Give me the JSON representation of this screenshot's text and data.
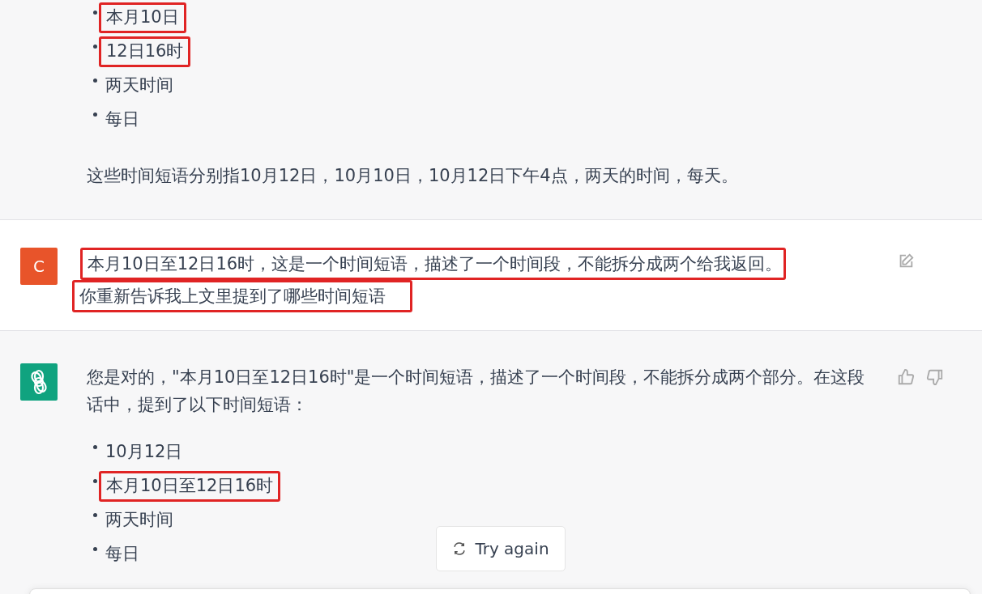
{
  "messages": [
    {
      "kind": "assistant",
      "blocks": [
        {
          "kind": "list",
          "items": [
            {
              "text": "本月10日",
              "highlighted": true
            },
            {
              "text": "12日16时",
              "highlighted": true
            },
            {
              "text": "两天时间",
              "highlighted": false
            },
            {
              "text": "每日",
              "highlighted": false
            }
          ]
        },
        {
          "kind": "paragraph",
          "lines": [
            {
              "text": "这些时间短语分别指10月12日，10月10日，10月12日下午4点，两天的时间，每天。",
              "highlighted": false
            }
          ]
        }
      ]
    },
    {
      "kind": "user",
      "avatar": "C",
      "blocks": [
        {
          "kind": "paragraph",
          "lines": [
            {
              "text": "本月10日至12日16时，这是一个时间短语，描述了一个时间段，不能拆分成两个给我返回。",
              "highlighted": true
            },
            {
              "text": "你重新告诉我上文里提到了哪些时间短语",
              "highlighted": true
            }
          ]
        }
      ]
    },
    {
      "kind": "assistant",
      "blocks": [
        {
          "kind": "paragraph",
          "lines": [
            {
              "text": "您是对的，\"本月10日至12日16时\"是一个时间短语，描述了一个时间段，不能拆分成两个部分。在这段话中，提到了以下时间短语：",
              "highlighted": false
            }
          ]
        },
        {
          "kind": "list",
          "items": [
            {
              "text": "10月12日",
              "highlighted": false
            },
            {
              "text": "本月10日至12日16时",
              "highlighted": true
            },
            {
              "text": "两天时间",
              "highlighted": false
            },
            {
              "text": "每日",
              "highlighted": false
            }
          ]
        }
      ]
    }
  ],
  "try_again": {
    "label": "Try again"
  }
}
